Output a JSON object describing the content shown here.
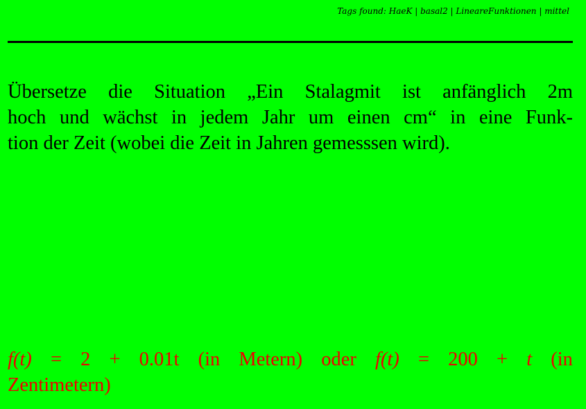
{
  "header": {
    "tags_text": "Tags found: HaeK | basal2 | LineareFunktionen | mittel"
  },
  "question": {
    "line1": "Übersetze die Situation „Ein Stalagmit ist anfänglich 2m",
    "line2": "hoch und wächst in jedem Jahr um einen cm“ in eine Funk-",
    "line3": "tion der Zeit (wobei die Zeit in Jahren gemesssen wird)."
  },
  "answer": {
    "tokens": [
      "f(t)",
      "=",
      "2",
      "+",
      "0.01t",
      "(in",
      "Metern)",
      "oder",
      "f(t)",
      "=",
      "200",
      "+",
      "t",
      "(in"
    ],
    "line2": "Zentimetern)"
  },
  "colors": {
    "background": "#00ff00",
    "answer_text": "#ee0000",
    "text": "#000000"
  }
}
